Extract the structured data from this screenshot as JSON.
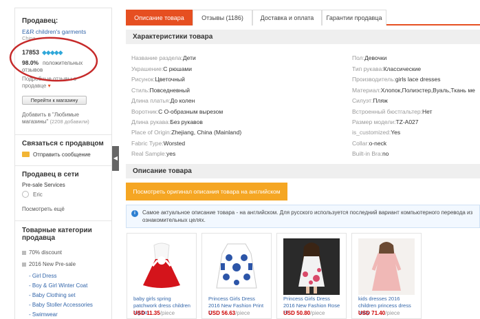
{
  "sidebar": {
    "seller_title": "Продавец:",
    "seller_name": "E&R children's garments",
    "seller_country": "China",
    "score": "17853",
    "positive_pct": "98.0%",
    "positive_label": "положительных",
    "reviews_label": "отзывов",
    "details_link_1": "Подробные отзывы о",
    "details_link_2": "продавце",
    "store_button": "Перейти к магазину",
    "favorites_line_1": "Добавить в \"Любимые",
    "favorites_line_2": "магазины\"",
    "favorites_count": "(2208 добавили)",
    "contact_title": "Связаться с продавцом",
    "send_message": "Отправить сообщение",
    "online_title": "Продавец в сети",
    "presale": "Pre-sale Services",
    "agent": "Eric",
    "see_more": "Посмотреть ещё",
    "categories_title_1": "Товарные категории",
    "categories_title_2": "продавца",
    "categories": [
      {
        "label": "70% discount",
        "level": 1
      },
      {
        "label": "2016 New Pre-sale",
        "level": 1
      },
      {
        "label": "Girl Dress",
        "level": 2
      },
      {
        "label": "Boy & Girl Winter Coat",
        "level": 2
      },
      {
        "label": "Baby Clothing set",
        "level": 2
      },
      {
        "label": "Baby Stoller Accessories",
        "level": 2
      },
      {
        "label": "Swimwear",
        "level": 2
      }
    ]
  },
  "tabs": [
    {
      "label": "Описание товара",
      "active": true
    },
    {
      "label": "Отзывы (1186)",
      "active": false
    },
    {
      "label": "Доставка и оплата",
      "active": false
    },
    {
      "label": "Гарантии продавца",
      "active": false
    }
  ],
  "specs_title": "Характеристики товара",
  "specs_left": [
    {
      "k": "Название раздела:",
      "v": "Дети"
    },
    {
      "k": "Украшение:",
      "v": "С рюшами"
    },
    {
      "k": "Рисунок:",
      "v": "Цветочный"
    },
    {
      "k": "Стиль:",
      "v": "Повседневный"
    },
    {
      "k": "Длина платья:",
      "v": "До колен"
    },
    {
      "k": "Воротник:",
      "v": "С О-образным вырезом"
    },
    {
      "k": "Длина рукава:",
      "v": "Без рукавов"
    },
    {
      "k": "Place of Origin:",
      "v": "Zhejiang, China (Mainland)"
    },
    {
      "k": "Fabric Type:",
      "v": "Worsted"
    },
    {
      "k": "Real Sample:",
      "v": "yes"
    }
  ],
  "specs_right": [
    {
      "k": "Пол:",
      "v": "Девочки"
    },
    {
      "k": "Тип рукава:",
      "v": "Классические"
    },
    {
      "k": "Производитель:",
      "v": "girls lace dresses"
    },
    {
      "k": "Материал:",
      "v": "Хлопок,Полиэстер,Вуаль,Ткань ме"
    },
    {
      "k": "Силуэт:",
      "v": "Пляж"
    },
    {
      "k": "Встроенный бюстгальтер:",
      "v": "Нет"
    },
    {
      "k": "Размер модели:",
      "v": "TZ-A027"
    },
    {
      "k": "is_customized:",
      "v": "Yes"
    },
    {
      "k": "Collar:",
      "v": "o-neck"
    },
    {
      "k": "Built-in Bra:",
      "v": "no"
    }
  ],
  "desc_title": "Описание товара",
  "orig_button": "Посмотреть оригинал описания товара на английском",
  "info_text_1": "Самое актуальное описание товара - на английском. Для русского используется последний вариант компьютерного перевода из",
  "info_text_2": "ознакомительных целях.",
  "products": [
    {
      "name": "baby girls spring patchwork dress children big bo",
      "price": "USD 11.35",
      "unit": "/piece"
    },
    {
      "name": "Princess Girls Dress 2016 New Fashion Print C",
      "price": "USD 56.63",
      "unit": "/piece"
    },
    {
      "name": "Princess Girls Dress 2016 New Fashion Rose Fl",
      "price": "USD 50.80",
      "unit": "/piece"
    },
    {
      "name": "kids dresses 2016 children princess dress baby",
      "price": "USD 71.40",
      "unit": "/piece"
    }
  ],
  "colors": {
    "accent": "#e64f21",
    "orange_button": "#f5a623",
    "annotation": "#c62a2a"
  }
}
